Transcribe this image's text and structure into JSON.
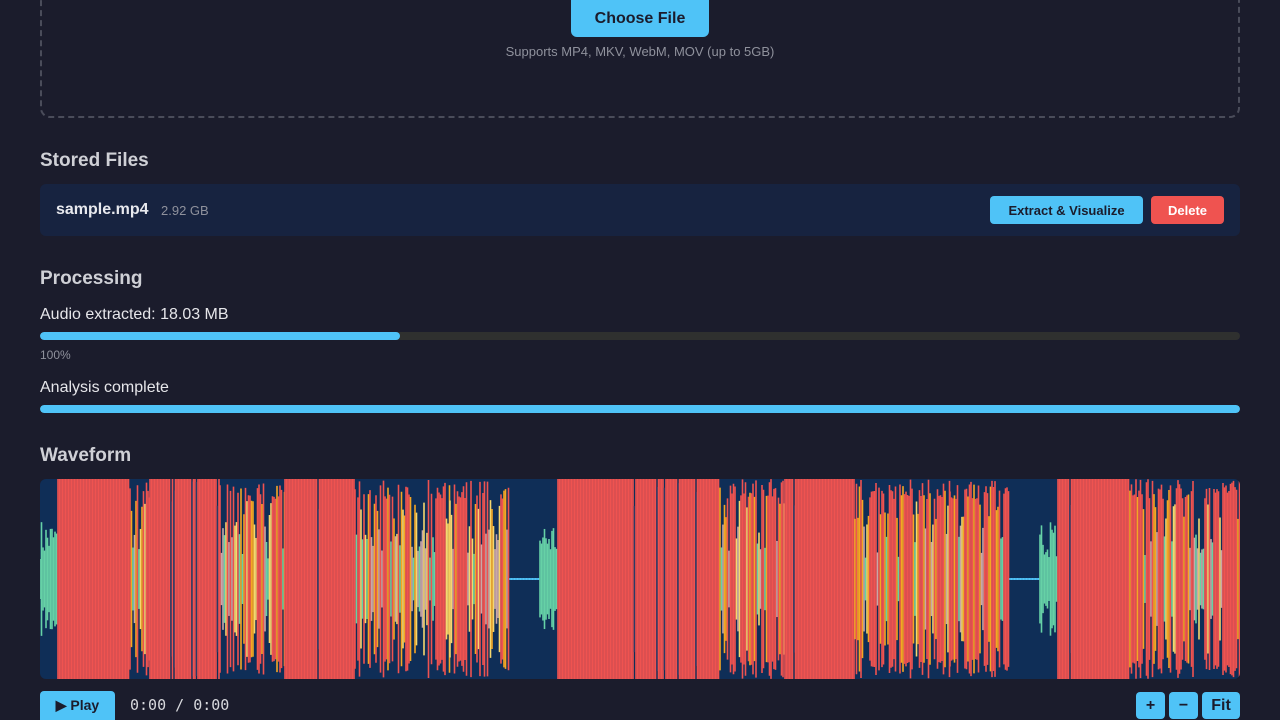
{
  "upload": {
    "choose_label": "Choose File",
    "supports": "Supports MP4, MKV, WebM, MOV (up to 5GB)"
  },
  "stored_files": {
    "title": "Stored Files",
    "items": [
      {
        "name": "sample.mp4",
        "size": "2.92 GB",
        "extract_label": "Extract & Visualize",
        "delete_label": "Delete"
      }
    ]
  },
  "processing": {
    "title": "Processing",
    "extract_status": "Audio extracted: 18.03 MB",
    "extract_progress": 0.3,
    "extract_percent": "100%",
    "analysis_status": "Analysis complete",
    "analysis_progress": 1.0
  },
  "waveform": {
    "title": "Waveform",
    "colors": {
      "background": "#0f2e57",
      "loud": "#ef5350",
      "mid": "#f5a623",
      "soft": "#f5d76e",
      "quiet": "#66d1a6",
      "silence": "#4fc3f7"
    }
  },
  "player": {
    "play_label": "▶ Play",
    "time": "0:00 / 0:00",
    "zoom_in_label": "+",
    "zoom_out_label": "−",
    "fit_label": "Fit"
  },
  "colors": {
    "accent": "#4fc3f7",
    "danger": "#ef5350",
    "background": "#1b1c2c",
    "card": "#172340"
  }
}
